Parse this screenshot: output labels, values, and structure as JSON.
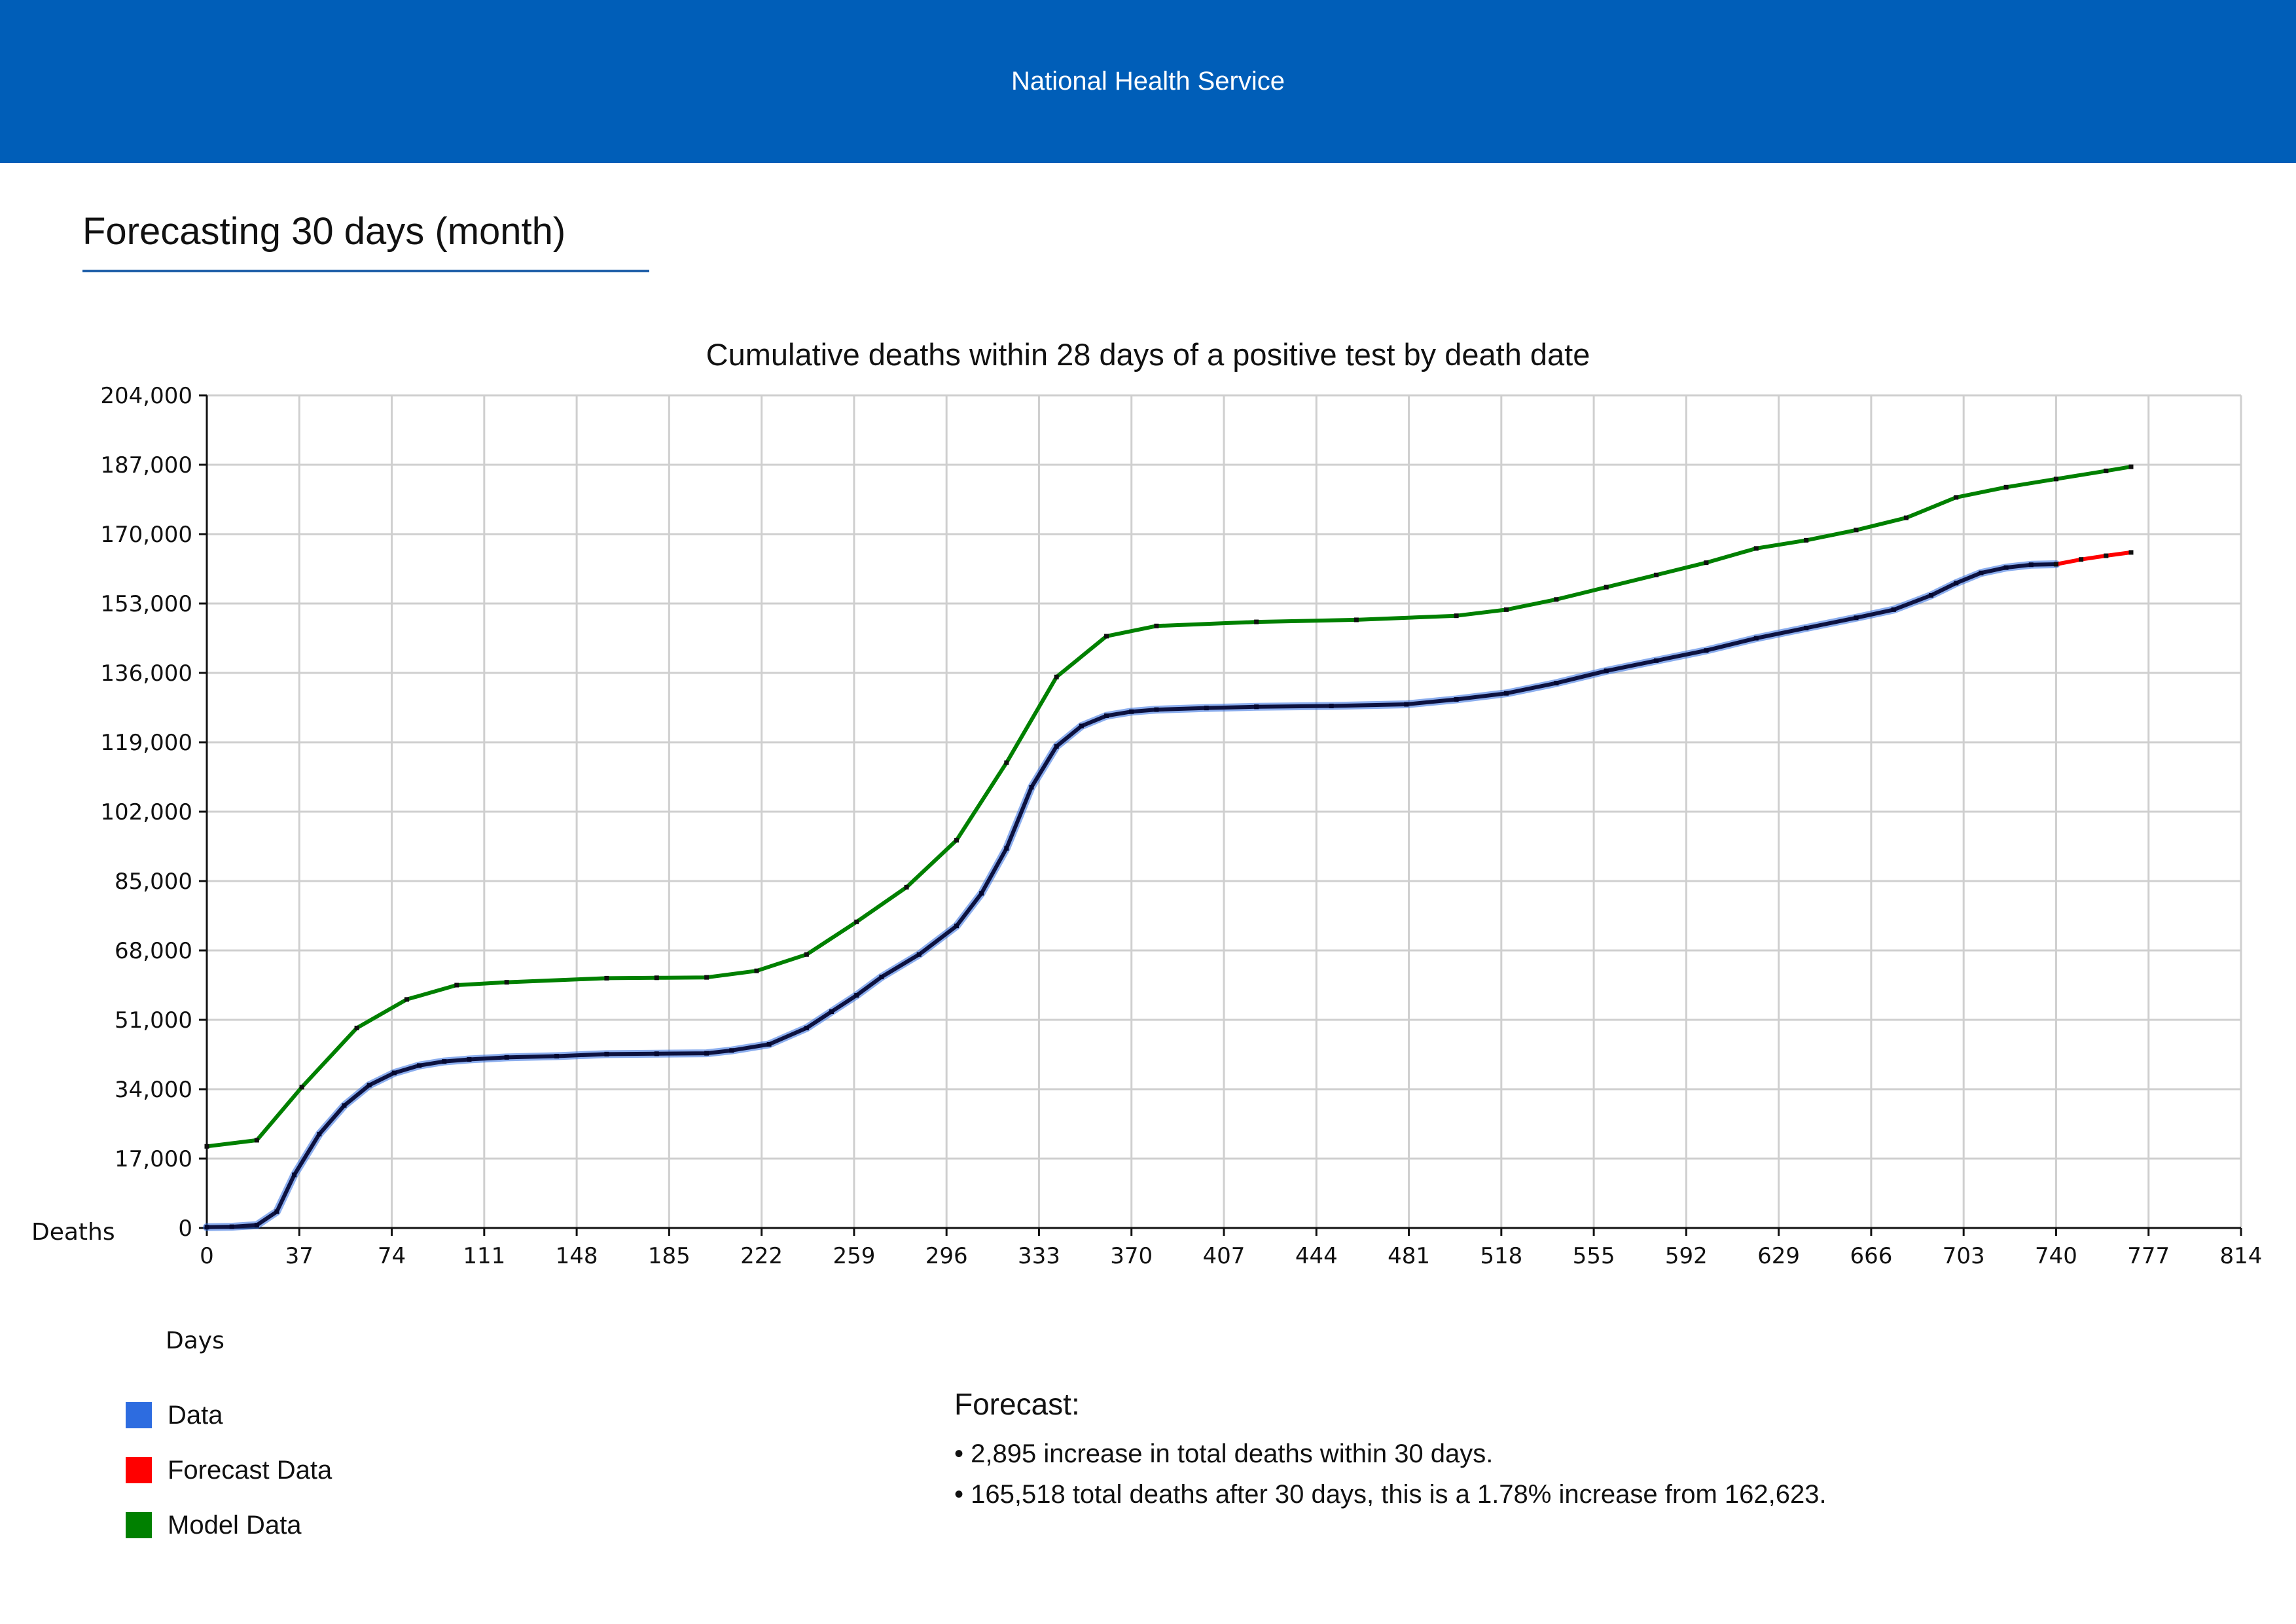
{
  "banner": {
    "title": "National Health Service",
    "color": "#005eb8"
  },
  "page": {
    "title": "Forecasting 30 days (month)"
  },
  "chart_data": {
    "type": "line",
    "title": "Cumulative deaths within 28 days of a positive test by death date",
    "xlabel": "Days",
    "ylabel": "Deaths",
    "xlim": [
      0,
      814
    ],
    "ylim": [
      0,
      204000
    ],
    "x_ticks": [
      "0",
      "37",
      "74",
      "111",
      "148",
      "185",
      "222",
      "259",
      "296",
      "333",
      "370",
      "407",
      "444",
      "481",
      "518",
      "555",
      "592",
      "629",
      "666",
      "703",
      "740",
      "777",
      "814"
    ],
    "y_ticks": [
      "0",
      "17,000",
      "34,000",
      "51,000",
      "68,000",
      "85,000",
      "102,000",
      "119,000",
      "136,000",
      "153,000",
      "170,000",
      "187,000",
      "204,000"
    ],
    "grid": true,
    "legend_position": "bottom-left",
    "series": [
      {
        "name": "Data",
        "color": "#2d6ce0",
        "line_color": "#0d1240",
        "x": [
          0,
          10,
          20,
          28,
          35,
          45,
          55,
          65,
          75,
          85,
          95,
          105,
          120,
          140,
          160,
          180,
          200,
          210,
          225,
          240,
          250,
          260,
          270,
          285,
          300,
          310,
          320,
          330,
          340,
          350,
          360,
          370,
          380,
          400,
          420,
          450,
          480,
          500,
          520,
          540,
          560,
          580,
          600,
          620,
          640,
          660,
          675,
          690,
          700,
          710,
          720,
          730,
          740
        ],
        "y": [
          200,
          300,
          700,
          4000,
          13000,
          23000,
          30000,
          35000,
          38000,
          39800,
          40800,
          41300,
          41800,
          42100,
          42600,
          42700,
          42800,
          43500,
          45000,
          49000,
          53000,
          57000,
          61500,
          67000,
          74000,
          82000,
          93000,
          108000,
          118000,
          123000,
          125500,
          126500,
          127000,
          127400,
          127700,
          127900,
          128300,
          129500,
          131000,
          133500,
          136500,
          139000,
          141500,
          144500,
          147000,
          149500,
          151500,
          155000,
          158000,
          160500,
          161800,
          162500,
          162623
        ]
      },
      {
        "name": "Forecast Data",
        "color": "#ff0000",
        "x": [
          740,
          750,
          760,
          770
        ],
        "y": [
          162623,
          163800,
          164700,
          165518
        ]
      },
      {
        "name": "Model Data",
        "color": "#008000",
        "x": [
          0,
          20,
          38,
          60,
          80,
          100,
          120,
          160,
          180,
          200,
          220,
          240,
          260,
          280,
          300,
          320,
          340,
          360,
          380,
          420,
          460,
          500,
          520,
          540,
          560,
          580,
          600,
          620,
          640,
          660,
          680,
          700,
          720,
          740,
          760,
          770
        ],
        "y": [
          20000,
          21500,
          34500,
          49000,
          56000,
          59500,
          60200,
          61200,
          61300,
          61400,
          63000,
          67000,
          75000,
          83500,
          95000,
          114000,
          135000,
          145000,
          147500,
          148500,
          149000,
          150000,
          151500,
          154000,
          157000,
          160000,
          163000,
          166500,
          168500,
          171000,
          174000,
          179000,
          181500,
          183500,
          185500,
          186500
        ]
      }
    ]
  },
  "legend": {
    "items": [
      {
        "label": "Data",
        "color": "#2d6ce0"
      },
      {
        "label": "Forecast Data",
        "color": "#ff0000"
      },
      {
        "label": "Model Data",
        "color": "#008000"
      }
    ]
  },
  "forecast": {
    "heading": "Forecast:",
    "lines": [
      "• 2,895 increase in total deaths within 30 days.",
      "• 165,518 total deaths after 30 days, this is a 1.78% increase from 162,623."
    ]
  }
}
